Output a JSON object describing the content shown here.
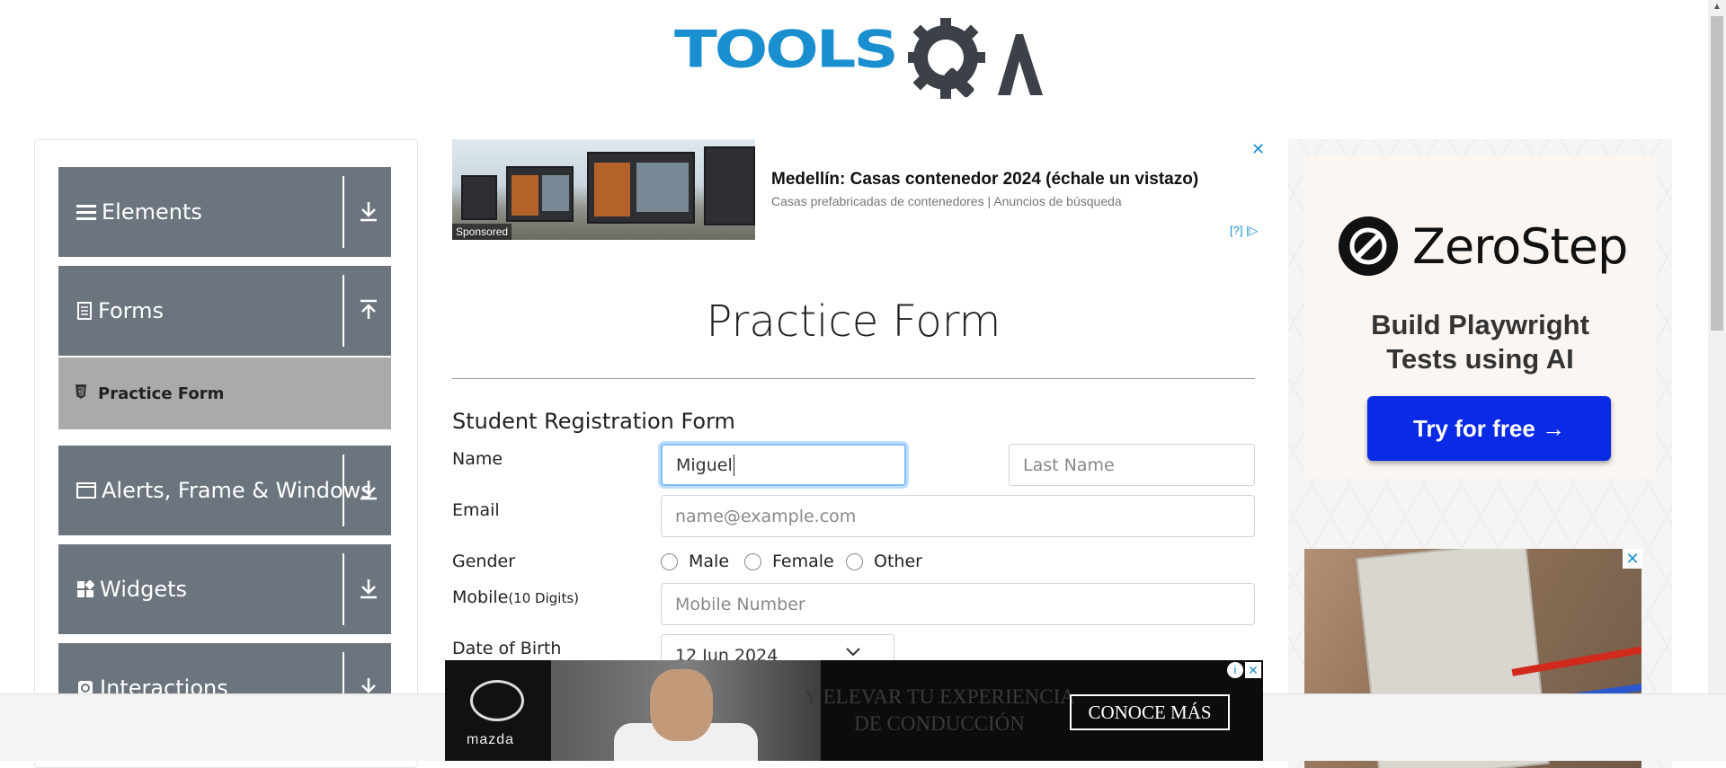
{
  "header": {
    "logo_text": "TOOLSQA",
    "logo_part1": "TOOLS",
    "logo_part2": "QA"
  },
  "sidebar": {
    "groups": [
      {
        "label": "Elements",
        "icon": "menu-icon",
        "arrow": "down"
      },
      {
        "label": "Forms",
        "icon": "document-icon",
        "arrow": "up"
      },
      {
        "label": "Alerts, Frame & Windows",
        "icon": "window-icon",
        "arrow": "down"
      },
      {
        "label": "Widgets",
        "icon": "widgets-icon",
        "arrow": "down"
      },
      {
        "label": "Interactions",
        "icon": "interactions-icon",
        "arrow": "down"
      }
    ],
    "active_item": {
      "label": "Practice Form",
      "icon": "html5-icon"
    }
  },
  "ad_top": {
    "headline": "Medellín: Casas contenedor 2024 (échale un vistazo)",
    "subtext": "Casas prefabricadas de contenedores | Anuncios de búsqueda",
    "sponsored_label": "Sponsored",
    "info_label": "[?]"
  },
  "main": {
    "page_title": "Practice Form",
    "form_heading": "Student Registration Form",
    "name_label": "Name",
    "first_name_value": "Miguel",
    "last_name_placeholder": "Last Name",
    "email_label": "Email",
    "email_placeholder": "name@example.com",
    "gender_label": "Gender",
    "gender_options": [
      "Male",
      "Female",
      "Other"
    ],
    "mobile_label": "Mobile",
    "mobile_hint": "(10 Digits)",
    "mobile_placeholder": "Mobile Number",
    "dob_label": "Date of Birth",
    "dob_value": "12 Jun 2024"
  },
  "ad_right": {
    "brand": "ZeroStep",
    "tagline_line1": "Build Playwright",
    "tagline_line2": "Tests using AI",
    "cta": "Try for free →"
  },
  "ad_bottom": {
    "brand": "mazda",
    "slogan_line1": "Y ELEVAR TU EXPERIENCIA",
    "slogan_line2": "DE CONDUCCIÓN",
    "cta": "CONOCE MÁS"
  },
  "colors": {
    "brand_blue": "#1a8fd0",
    "sidebar_group_bg": "#6c757d",
    "sidebar_active_bg": "#aaaaaa",
    "cta_blue": "#0a2ae6"
  }
}
